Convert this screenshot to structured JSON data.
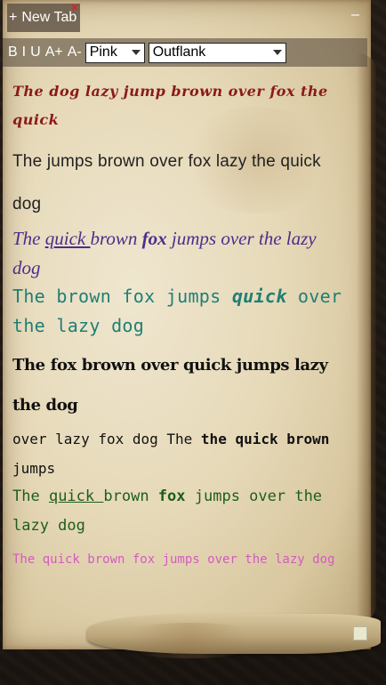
{
  "tab": {
    "plus": "+",
    "title": "New Tab",
    "close": "×"
  },
  "window": {
    "minimize": "–"
  },
  "toolbar": {
    "bold": "B",
    "italic": "I",
    "underline": "U",
    "font_bigger": "A+",
    "font_smaller": "A-",
    "color_value": "Pink",
    "font_value": "Outflank"
  },
  "lines": {
    "l1": "The dog lazy jump brown over fox the quick",
    "l2": "The jumps brown over fox lazy the quick dog",
    "l3": {
      "p1": "The ",
      "p2": "quick ",
      "p3": "brown ",
      "p4": "fox",
      "p5": " jumps over the lazy dog"
    },
    "l4": {
      "p1": "The brown fox jumps ",
      "p2": "quick",
      "p3": " over the lazy dog"
    },
    "l5": "The fox brown over quick jumps lazy the dog",
    "l6": {
      "p1": "over lazy fox dog The ",
      "p2": "the quick brown",
      "p3": " jumps"
    },
    "l7": {
      "p1": "The ",
      "p2": "quick ",
      "p3": "brown ",
      "p4": "fox",
      "p5": " jumps over the lazy dog"
    },
    "l8": "The quick brown fox jumps over the lazy dog"
  },
  "colors": {
    "parchment": "#e6d9b8",
    "line1": "#8b1a1a",
    "line3": "#4a2e8c",
    "line4": "#1f7f74",
    "line7": "#1e5e1a",
    "line8": "#d65ac0"
  }
}
